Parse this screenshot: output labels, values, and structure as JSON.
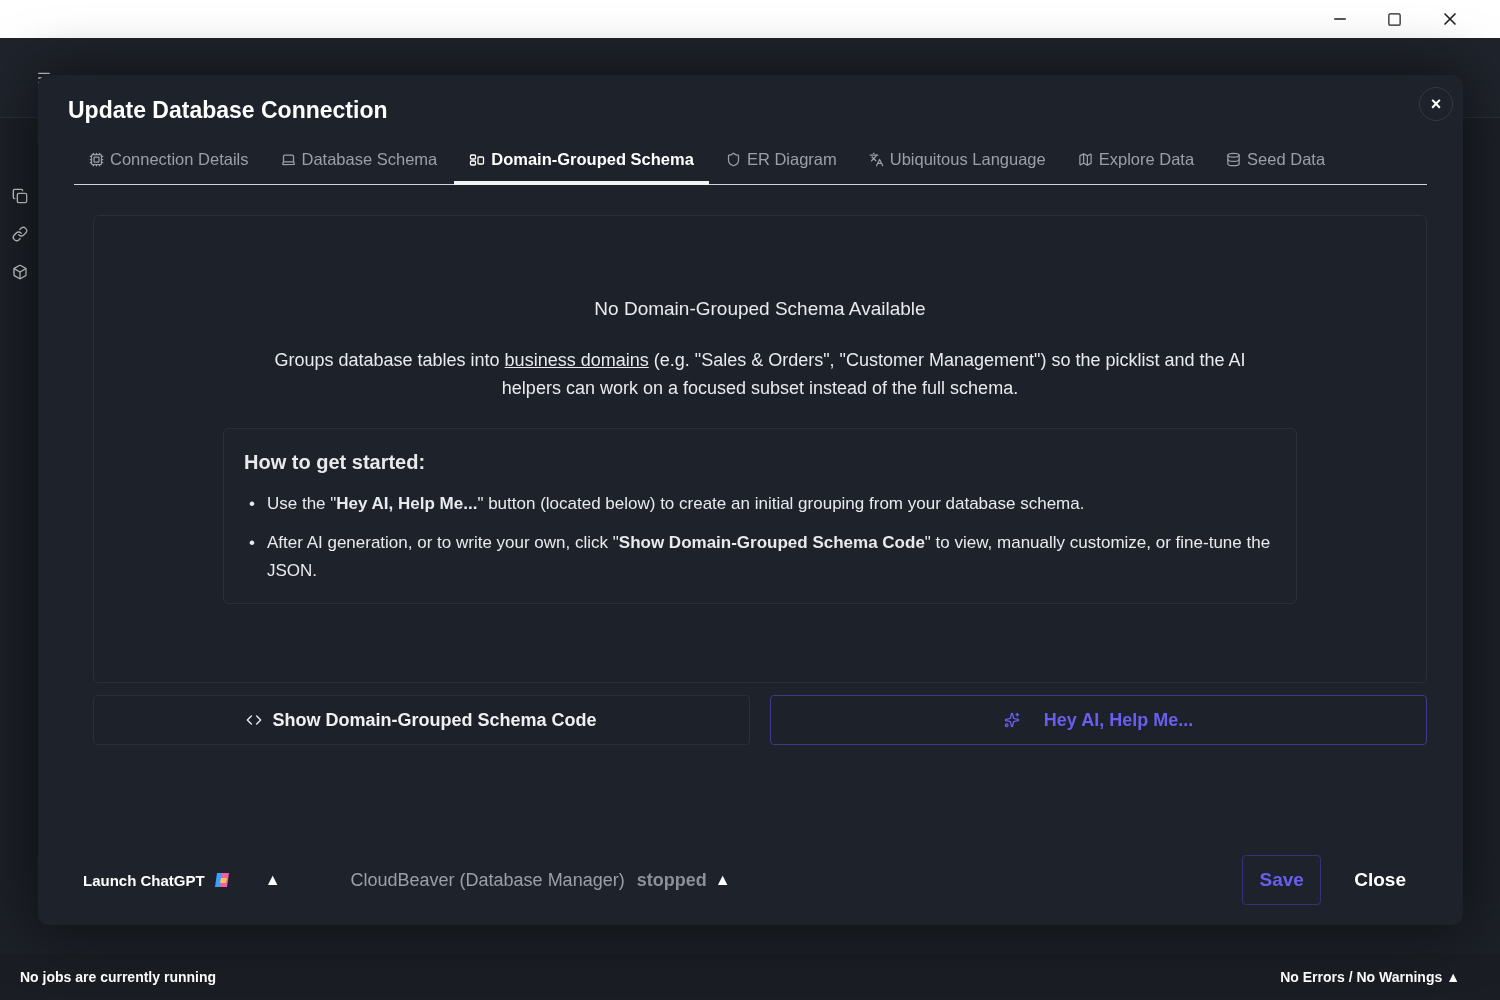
{
  "dialog": {
    "title": "Update Database Connection",
    "close_label": "×",
    "tabs": [
      {
        "label": "Connection Details",
        "selected": false
      },
      {
        "label": "Database Schema",
        "selected": false
      },
      {
        "label": "Domain-Grouped Schema",
        "selected": true
      },
      {
        "label": "ER Diagram",
        "selected": false
      },
      {
        "label": "Ubiquitous Language",
        "selected": false
      },
      {
        "label": "Explore Data",
        "selected": false
      },
      {
        "label": "Seed Data",
        "selected": false
      }
    ],
    "empty_state": {
      "heading": "No Domain-Grouped Schema Available",
      "description": {
        "before": "Groups database tables into",
        "link": "business domains",
        "after": "(e.g. \"Sales & Orders\", \"Customer Management\") so the picklist and the AI helpers can work on a focused subset instead of the full schema."
      },
      "guide": {
        "title": "How to get started:",
        "steps": [
          {
            "bullet": "•",
            "text": "Use the \"**Hey AI, Help Me...**\" button (located below) to create an initial grouping from your database schema."
          },
          {
            "bullet": "•",
            "text": "After AI generation, or to write your own, click \"**Show Domain-Grouped Schema Code**\" to view, manually customize, or fine-tune the JSON."
          }
        ]
      }
    },
    "actions": [
      {
        "label": "Show Domain-Grouped Schema Code",
        "kind": "code"
      },
      {
        "label": "Hey AI, Help Me...",
        "kind": "ai"
      }
    ],
    "footer": {
      "chatgpt": "Launch ChatGPT",
      "chatgpt_toggle": "▲",
      "service": "CloudBeaver (Database Manager)",
      "service_status": "stopped",
      "service_toggle": "▲",
      "save": "Save",
      "close": "Close"
    }
  },
  "status_bar": {
    "jobs": "No jobs are currently running",
    "problems": "No Errors / No Warnings ▲"
  }
}
